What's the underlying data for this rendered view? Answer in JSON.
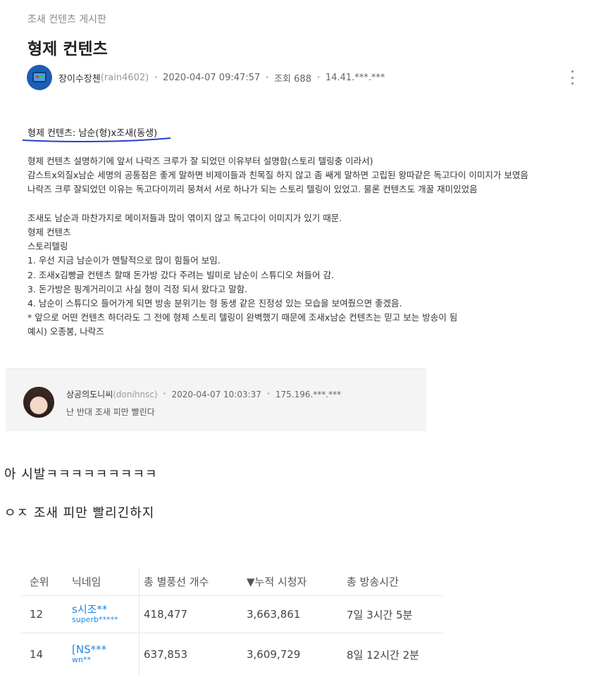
{
  "board": "조새 컨텐츠 게시판",
  "post": {
    "title": "형제 컨텐츠",
    "author": "장이수장첸",
    "handle": "(rain4602)",
    "datetime": "2020-04-07 09:47:57",
    "views": "조회 688",
    "ip": "14.41.***.***",
    "subheading": "형제 컨텐츠: 남순(형)x조새(동생)",
    "lines": [
      "형제 컨텐츠 설명하기에 앞서 나락즈 크루가 잘 되었던 이유부터 설명함(스토리 텔링충 이라서)",
      "감스트x외질x남순 세명의 공통점은 좋게 말하면 비제이들과 친목질 하지 않고 좀 쌔게 말하면 고립된 왕따같은 독고다이 이미지가 보였음",
      "나락즈 크루 잘되었던 이유는 독고다이끼리 뭉쳐서 서로 하나가 되는 스토리 텔링이 있었고. 물론 컨텐츠도 개꿀 재미있었음",
      "",
      "조새도 남순과 마찬가지로 메이저들과 많이 엮이지 않고 독고다이 이미지가 있기 때문.",
      "형제 컨텐츠",
      "스토리텔링",
      "1. 우선 지금 남순이가 멘탈적으로 많이 힘들어 보임.",
      "2. 조새x김빵글 컨텐츠 할때 돈가방 갔다 주려는 빌미로 남순이 스튜디오 쳐들어 감.",
      "3. 돈가방은 핑계거리이고 사실 형이 걱정 되서 왔다고 말함.",
      "4. 남순이 스튜디오 들어가게 되면 방송 분위기는 형 동생 같은 진정성 있는 모습을 보여줬으면 좋겠음.",
      "  * 앞으로 어떤 컨텐츠 하더라도 그 전에 형제 스토리 텔링이 완벽했기 때문에 조새x남순 컨텐츠는 믿고 보는 방송이 됨",
      " 예시) 오종봉, 나락즈"
    ]
  },
  "comment": {
    "author": "상공의도니씨",
    "handle": "(donihnsc)",
    "datetime": "2020-04-07 10:03:37",
    "ip": "175.196.***.***",
    "text": "난 반대   조새 피만 빨린다"
  },
  "reply1": "아 시발ㅋㅋㅋㅋㅋㅋㅋㅋㅋ",
  "reply2": "ㅇㅈ 조새 피만 빨리긴하지",
  "ranking": {
    "headers": [
      "순위",
      "닉네임",
      "총 별풍선 개수",
      "▼누적 시청자",
      "총 방송시간"
    ],
    "rows": [
      {
        "rank": "12",
        "nick": "s시조**",
        "id": "superb*****",
        "balloons": "418,477",
        "viewers": "3,663,861",
        "time": "7일 3시간 5분"
      },
      {
        "rank": "14",
        "nick": "[NS***",
        "id": "wn**",
        "balloons": "637,853",
        "viewers": "3,609,729",
        "time": "8일 12시간 2분"
      }
    ]
  }
}
